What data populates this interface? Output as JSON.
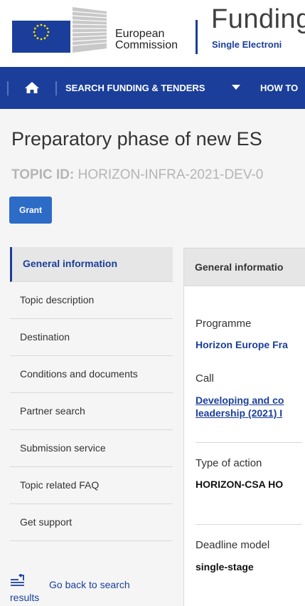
{
  "header": {
    "org_line1": "European",
    "org_line2": "Commission",
    "site_title": "Funding",
    "site_subtitle": "Single Electroni"
  },
  "nav": {
    "home_icon": "home-icon",
    "item_search": "SEARCH FUNDING & TENDERS",
    "item_howto": "HOW TO"
  },
  "page": {
    "title": "Preparatory phase of new ES",
    "topic_id_label": "TOPIC ID:",
    "topic_id_value": "HORIZON-INFRA-2021-DEV-0",
    "grant_label": "Grant"
  },
  "sidebar": {
    "items": [
      {
        "label": "General information"
      },
      {
        "label": "Topic description"
      },
      {
        "label": "Destination"
      },
      {
        "label": "Conditions and documents"
      },
      {
        "label": "Partner search"
      },
      {
        "label": "Submission service"
      },
      {
        "label": "Topic related FAQ"
      },
      {
        "label": "Get support"
      }
    ],
    "back_link": "Go back to search results"
  },
  "card": {
    "header": "General informatio",
    "programme_label": "Programme",
    "programme_value": "Horizon Europe Fra",
    "call_label": "Call",
    "call_line1": "Developing and co",
    "call_line2": "leadership (2021) I",
    "type_label": "Type of action",
    "type_value": "HORIZON-CSA HO",
    "deadline_label": "Deadline model",
    "deadline_value": "single-stage"
  },
  "colors": {
    "brand_blue": "#1a3e9a",
    "button_blue": "#2d6cc6"
  }
}
